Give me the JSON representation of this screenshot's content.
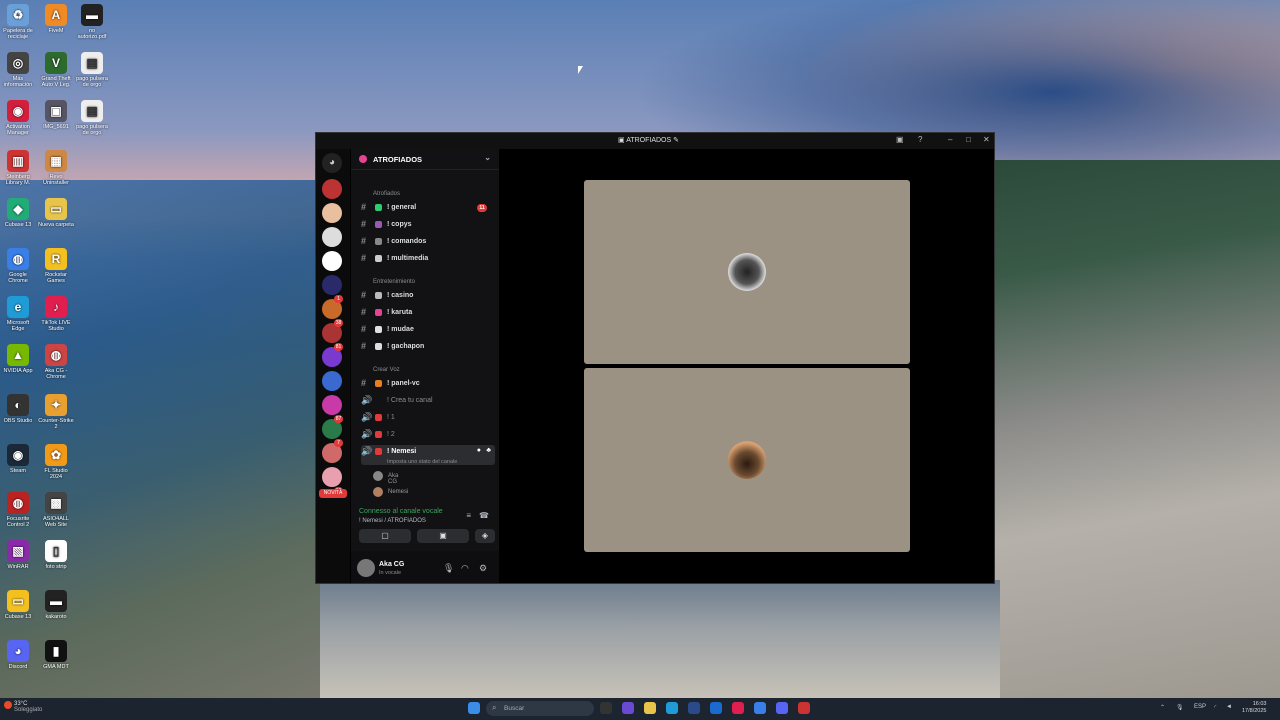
{
  "desktop": {
    "icons": [
      {
        "label": "Papelera de reciclaje",
        "color": "#6aa0d8",
        "glyph": "♻"
      },
      {
        "label": "FiveM",
        "color": "#f08a24",
        "glyph": "A"
      },
      {
        "label": "no autorizo.pdf",
        "color": "#222",
        "glyph": "▬"
      },
      {
        "label": "Más información",
        "color": "#444",
        "glyph": "◎"
      },
      {
        "label": "Grand Theft Auto V Leg.",
        "color": "#2d6a2d",
        "glyph": "V"
      },
      {
        "label": "pago pulsera de orgo",
        "color": "#eee",
        "glyph": "▤"
      },
      {
        "label": "Activation Manager",
        "color": "#d21f3c",
        "glyph": "◉"
      },
      {
        "label": "IMG_5691",
        "color": "#556",
        "glyph": "▣"
      },
      {
        "label": "pago pulsera de orgo",
        "color": "#eee",
        "glyph": "▤"
      },
      {
        "label": "Steinberg Library M.",
        "color": "#c33",
        "glyph": "▥"
      },
      {
        "label": "Revo Uninstaller",
        "color": "#c84",
        "glyph": "▦"
      },
      {
        "label": "Cubase 13",
        "color": "#2a7",
        "glyph": "◆"
      },
      {
        "label": "Nueva carpeta",
        "color": "#e8c54a",
        "glyph": "▭"
      },
      {
        "label": "Google Chrome",
        "color": "#3a7ee8",
        "glyph": "◍"
      },
      {
        "label": "Rockstar Games",
        "color": "#f4c020",
        "glyph": "R"
      },
      {
        "label": "Microsoft Edge",
        "color": "#1f9bd6",
        "glyph": "e"
      },
      {
        "label": "TikTok LIVE Studio",
        "color": "#e01f4f",
        "glyph": "♪"
      },
      {
        "label": "NVIDIA App",
        "color": "#76b900",
        "glyph": "▲"
      },
      {
        "label": "Aka CG - Chrome",
        "color": "#c44",
        "glyph": "◍"
      },
      {
        "label": "OBS Studio",
        "color": "#333",
        "glyph": "◐"
      },
      {
        "label": "Counter-Strike 2",
        "color": "#e8a030",
        "glyph": "✦"
      },
      {
        "label": "Steam",
        "color": "#1b2838",
        "glyph": "◉"
      },
      {
        "label": "FL Studio 2024",
        "color": "#f29a18",
        "glyph": "✿"
      },
      {
        "label": "Focusrite Control 2",
        "color": "#b22",
        "glyph": "◍"
      },
      {
        "label": "ASIO4ALL Web Site",
        "color": "#444",
        "glyph": "▩"
      },
      {
        "label": "WinRAR",
        "color": "#8a2aa8",
        "glyph": "▧"
      },
      {
        "label": "foto strip",
        "color": "#fff",
        "glyph": "▯"
      },
      {
        "label": "Cubase 13",
        "color": "#f4c020",
        "glyph": "▭"
      },
      {
        "label": "kakaroto",
        "color": "#222",
        "glyph": "▬"
      },
      {
        "label": "Discord",
        "color": "#5865f2",
        "glyph": "◕"
      },
      {
        "label": "GMA MDT",
        "color": "#111",
        "glyph": "▮"
      }
    ]
  },
  "window": {
    "title": "ATROFIADOS",
    "title_icon": "folder-icon"
  },
  "server": {
    "name": "ATROFIADOS",
    "rail_badges": [
      "1",
      "38",
      "81",
      "87",
      "7",
      "16"
    ],
    "new_label": "NOVITÀ"
  },
  "channels": {
    "categories": [
      "Atrofiados",
      "Entretenimiento",
      "Crear Voz"
    ],
    "text": [
      {
        "label": "! general",
        "unread": "11",
        "emoji_color": "#2ecc71"
      },
      {
        "label": "! copys",
        "emoji_color": "#9b59b6"
      },
      {
        "label": "! comandos",
        "emoji_color": "#888"
      },
      {
        "label": "! multimedia",
        "emoji_color": "#ccc"
      },
      {
        "label": "! casino",
        "emoji_color": "#bbb"
      },
      {
        "label": "! karuta",
        "emoji_color": "#e84393"
      },
      {
        "label": "! mudae",
        "emoji_color": "#e0e0e0"
      },
      {
        "label": "! gachapon",
        "emoji_color": "#ddd"
      },
      {
        "label": "! panel-vc",
        "emoji_color": "#e67e22"
      }
    ],
    "voice": [
      {
        "label": "! Crea tu canal"
      },
      {
        "label": "! 1"
      },
      {
        "label": "! 2"
      },
      {
        "label": "! Nemesi"
      }
    ],
    "status_placeholder": "Imposta uno stato del canale",
    "members": [
      "Aka CG",
      "Nemesi"
    ]
  },
  "voice_connection": {
    "status": "Connesso al canale vocale",
    "location": "! Nemesi / ATROFIADOS"
  },
  "user": {
    "name": "Aka CG",
    "status": "In vocale"
  },
  "taskbar": {
    "weather_temp": "33°C",
    "weather_desc": "Soleggiato",
    "search_placeholder": "Buscar",
    "language": "ESP",
    "time": "16:03",
    "date": "17/8/2025"
  }
}
